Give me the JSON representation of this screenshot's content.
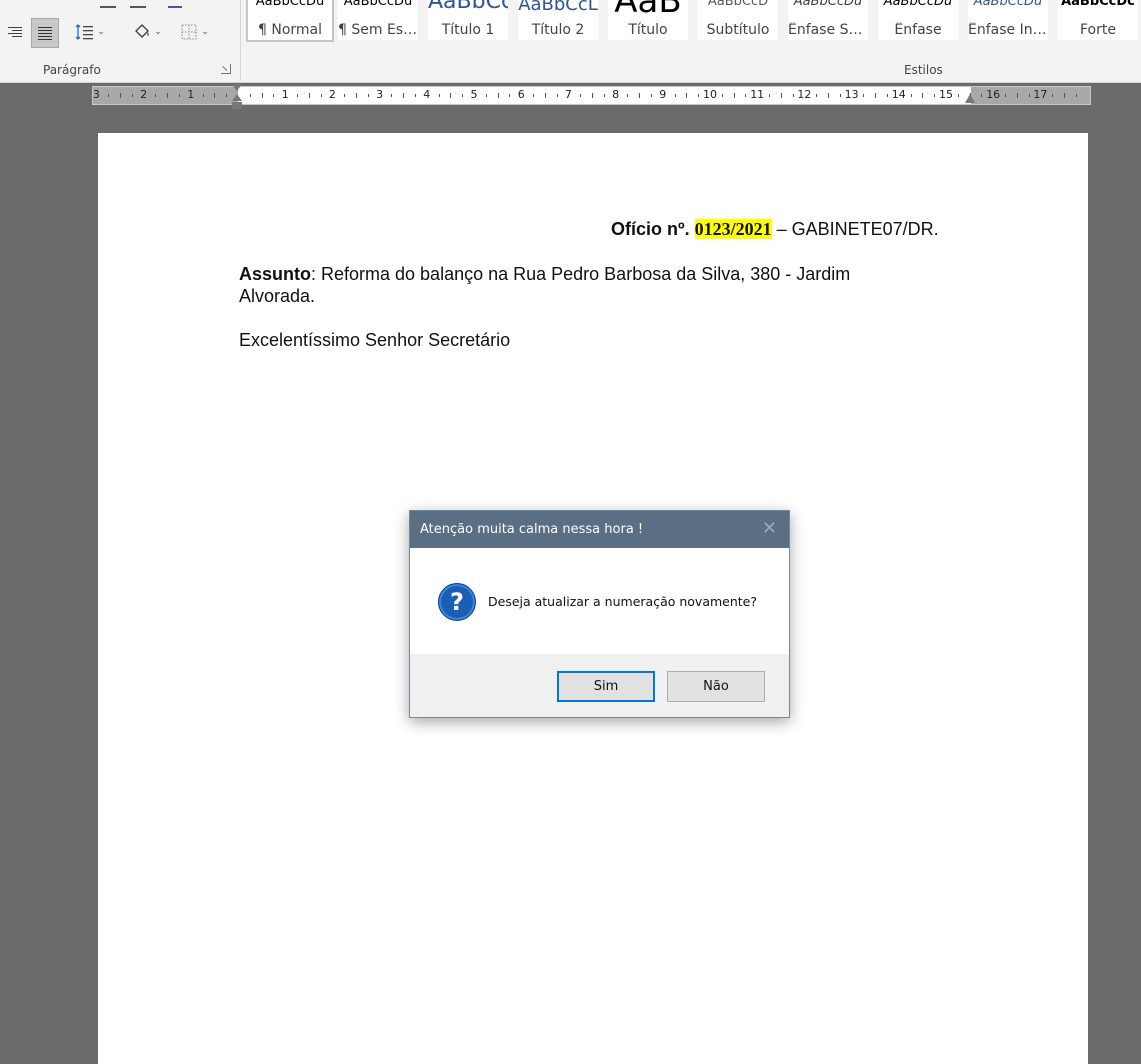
{
  "ribbon": {
    "paragraph_group_label": "Parágrafo",
    "styles_group_label": "Estilos",
    "styles": [
      {
        "sample": "AaBbCcDu",
        "name": "¶ Normal",
        "color": "#000000"
      },
      {
        "sample": "AaBbCcDu",
        "name": "¶ Sem Esp...",
        "color": "#000000"
      },
      {
        "sample": "AaBbCc",
        "name": "Título 1",
        "color": "#2f5597"
      },
      {
        "sample": "AaBbCcL",
        "name": "Título 2",
        "color": "#2f5597"
      },
      {
        "sample": "AaB",
        "name": "Título",
        "color": "#000000"
      },
      {
        "sample": "AaBbCcD",
        "name": "Subtítulo",
        "color": "#595959"
      },
      {
        "sample": "AaBbCcDu",
        "name": "Ênfase Sutil",
        "color": "#404040"
      },
      {
        "sample": "AaBbCcDu",
        "name": "Ênfase",
        "color": "#000000"
      },
      {
        "sample": "AaBbCcDu",
        "name": "Ênfase Int...",
        "color": "#2f5597"
      },
      {
        "sample": "AaBbCcDc",
        "name": "Forte",
        "color": "#000000"
      }
    ]
  },
  "ruler": {
    "left_labels": [
      "3",
      "2",
      "1"
    ],
    "right_labels": [
      "1",
      "2",
      "3",
      "4",
      "5",
      "6",
      "7",
      "8",
      "9",
      "10",
      "11",
      "12",
      "13",
      "14",
      "15",
      "16",
      "17"
    ]
  },
  "document": {
    "oficio_prefix": "Ofício nº.",
    "oficio_number": "0123/2021",
    "oficio_suffix": "– GABINETE07/DR.",
    "assunto_label": "Assunto",
    "assunto_text_line1": ": Reforma do balanço na Rua Pedro Barbosa da Silva, 380 - Jardim",
    "assunto_text_line2": "Alvorada.",
    "salutation": "Excelentíssimo Senhor Secretário"
  },
  "dialog": {
    "title": "Atenção muita calma nessa hora !",
    "close_glyph": "✕",
    "icon_glyph": "?",
    "message": "Deseja atualizar a numeração novamente?",
    "yes_label": "Sim",
    "no_label": "Não"
  },
  "colors": {
    "highlight": "#ffff00",
    "dialog_title_bg": "#5a6e84",
    "default_button_border": "#0078d7",
    "question_icon": "#1a5fb4"
  }
}
